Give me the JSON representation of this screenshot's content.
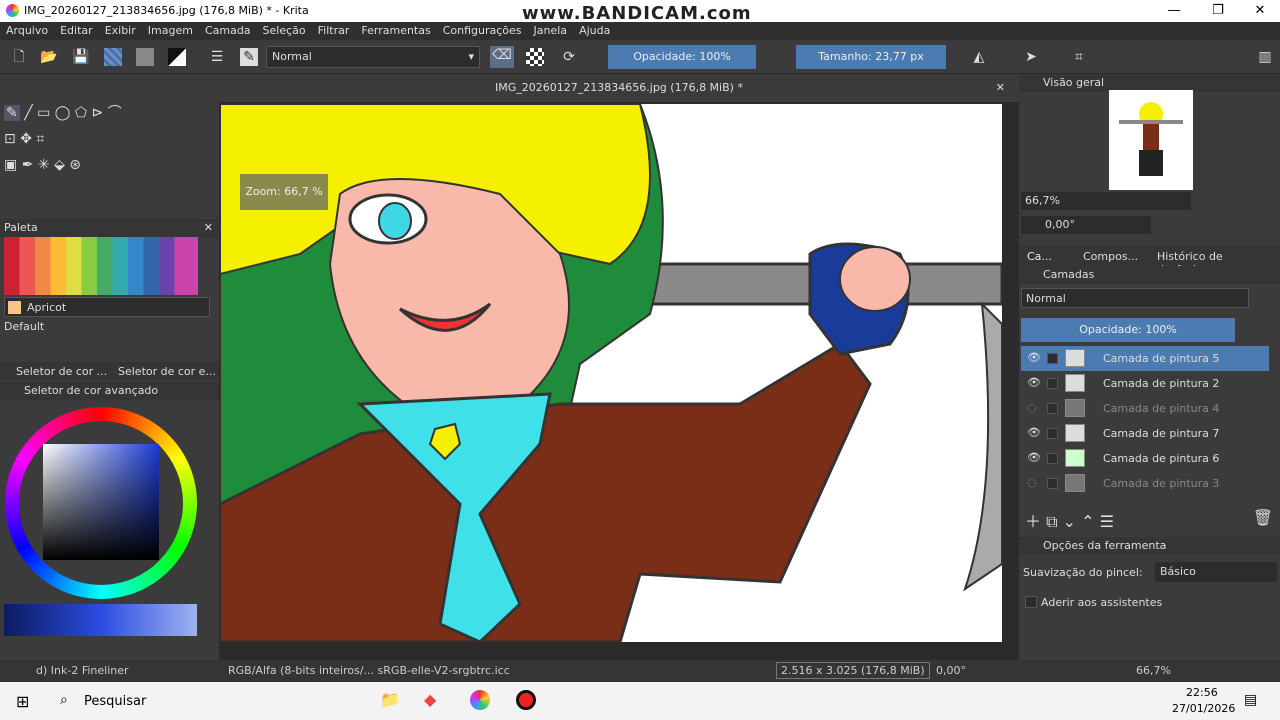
{
  "window": {
    "title": "IMG_20260127_213834656.jpg (176,8 MiB) * - Krita",
    "watermark": "www.BANDICAM.com",
    "minimize": "—",
    "maximize": "❐",
    "close": "✕"
  },
  "menu": [
    "Arquivo",
    "Editar",
    "Exibir",
    "Imagem",
    "Camada",
    "Seleção",
    "Filtrar",
    "Ferramentas",
    "Configurações",
    "Janela",
    "Ajuda"
  ],
  "toolbar": {
    "blend_mode": "Normal",
    "opacity": "Opacidade: 100%",
    "size": "Tamanho: 23,77 px"
  },
  "document": {
    "tab_title": "IMG_20260127_213834656.jpg (176,8 MiB) *",
    "zoom_overlay": "Zoom: 66,7 %"
  },
  "palette": {
    "title": "Paleta",
    "selected_color": "Apricot",
    "set_name": "Default"
  },
  "color_selector": {
    "tab1": "Seletor de cor ...",
    "tab2": "Seletor de cor e...",
    "title": "Seletor de cor avançado"
  },
  "overview": {
    "title": "Visão geral",
    "zoom": "66,7%",
    "angle": "0,00°"
  },
  "docker_tabs": [
    "Ca...",
    "Compos...",
    "Histórico de desfazim..."
  ],
  "layers": {
    "title": "Camadas",
    "blend": "Normal",
    "opacity": "Opacidade:  100%",
    "items": [
      {
        "name": "Camada de pintura 5",
        "visible": true,
        "active": true
      },
      {
        "name": "Camada de pintura 2",
        "visible": true,
        "active": false
      },
      {
        "name": "Camada de pintura 4",
        "visible": false,
        "active": false
      },
      {
        "name": "Camada de pintura 7",
        "visible": true,
        "active": false
      },
      {
        "name": "Camada de pintura 6",
        "visible": true,
        "active": false
      },
      {
        "name": "Camada de pintura 3",
        "visible": false,
        "active": false
      }
    ]
  },
  "tool_options": {
    "title": "Opções da ferramenta",
    "smoothing_label": "Suavização do pincel:",
    "smoothing_value": "Básico",
    "assistants": "Aderir aos assistentes"
  },
  "status": {
    "brush": "d) Ink-2 Fineliner",
    "color_space": "RGB/Alfa (8-bits inteiros/...  sRGB-elle-V2-srgbtrc.icc",
    "dimensions": "2.516 x 3.025 (176,8 MiB)",
    "rotation": "0,00°",
    "zoom": "66,7%"
  },
  "taskbar": {
    "search": "Pesquisar",
    "time": "22:56",
    "date": "27/01/2026"
  }
}
